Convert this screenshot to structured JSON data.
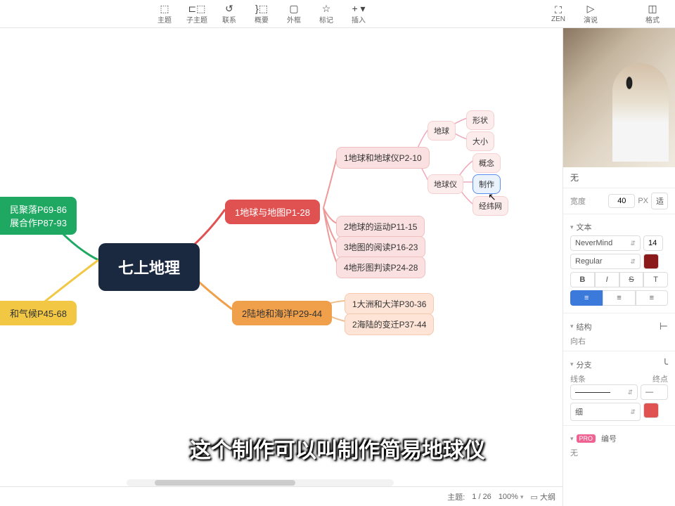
{
  "toolbar": {
    "topic": "主题",
    "subtopic": "子主题",
    "relation": "联系",
    "summary": "概要",
    "boundary": "外框",
    "marker": "标记",
    "insert": "插入",
    "zen": "ZEN",
    "present": "演说",
    "format": "格式"
  },
  "mindmap": {
    "center": "七上地理",
    "green_lines": [
      "民聚落P69-86",
      "展合作P87-93"
    ],
    "yellow": "和气候P45-68",
    "red": "1地球与地图P1-28",
    "orange": "2陆地和海洋P29-44",
    "red_children": {
      "c1": "1地球和地球仪P2-10",
      "c2": "2地球的运动P11-15",
      "c3": "3地图的阅读P16-23",
      "c4": "4地形图判读P24-28"
    },
    "orange_children": {
      "c1": "1大洲和大洋P30-36",
      "c2": "2海陆的变迁P37-44"
    },
    "globe_nodes": {
      "earth": "地球",
      "globe": "地球仪"
    },
    "leaf": {
      "shape": "形状",
      "size": "大小",
      "concept": "概念",
      "make": "制作",
      "grid": "经纬网"
    }
  },
  "side": {
    "none": "无",
    "width_label": "宽度",
    "width_val": "40",
    "width_unit": "PX",
    "fit": "适",
    "text_label": "文本",
    "font": "NeverMind",
    "fontsize": "14",
    "weight": "Regular",
    "struct_label": "结构",
    "struct_dir": "向右",
    "branch_label": "分支",
    "line_label": "线条",
    "end_label": "终点",
    "line_weight": "细",
    "number_label": "编号",
    "number_val": "无"
  },
  "status": {
    "topic_label": "主题:",
    "topic_count": "1 / 26",
    "zoom": "100%",
    "outline": "大纲"
  },
  "subtitle": "这个制作可以叫制作简易地球仪"
}
